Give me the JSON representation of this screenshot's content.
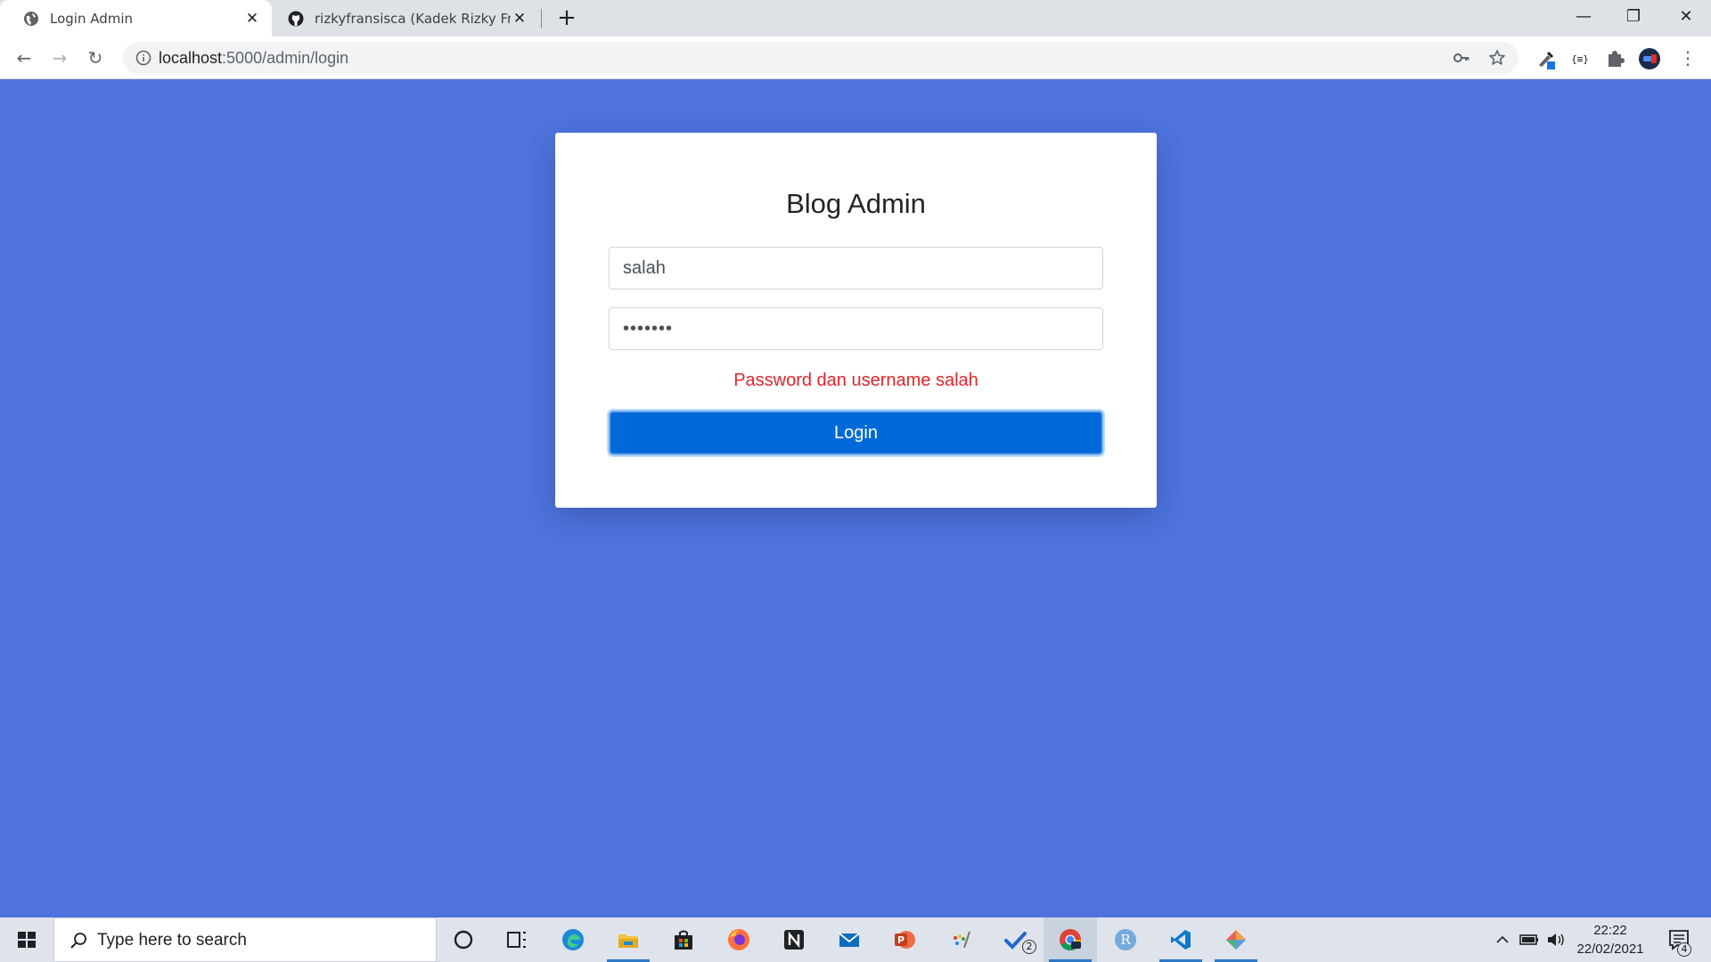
{
  "browser": {
    "tabs": [
      {
        "title": "Login Admin",
        "close": "✕"
      },
      {
        "title": "rizkyfransisca (Kadek Rizky Fransisca)",
        "close": "✕"
      }
    ],
    "new_tab": "+",
    "window_controls": {
      "minimize": "—",
      "maximize": "❐",
      "close": "✕"
    },
    "nav": {
      "back": "←",
      "forward": "→",
      "reload": "↻"
    },
    "url": {
      "host": "localhost",
      "path": ":5000/admin/login"
    },
    "menu": "⋮"
  },
  "page": {
    "heading": "Blog Admin",
    "username_value": "salah",
    "password_value": "•••••••",
    "error_message": "Password dan username salah",
    "login_label": "Login"
  },
  "taskbar": {
    "search_placeholder": "Type here to search",
    "apps": [
      "cortana-icon",
      "task-view-icon",
      "edge-icon",
      "file-explorer-icon",
      "store-icon",
      "firefox-icon",
      "notion-icon",
      "mail-icon",
      "powerpoint-icon",
      "paint-icon",
      "todo-icon",
      "chrome-icon",
      "r-icon",
      "vscode-icon",
      "git-icon"
    ],
    "todo_badge": "2",
    "notification_badge": "4",
    "time": "22:22",
    "date": "22/02/2021"
  },
  "colors": {
    "page_background": "#4e73de",
    "button_primary": "#0069d9",
    "error_text": "#e3242b"
  }
}
